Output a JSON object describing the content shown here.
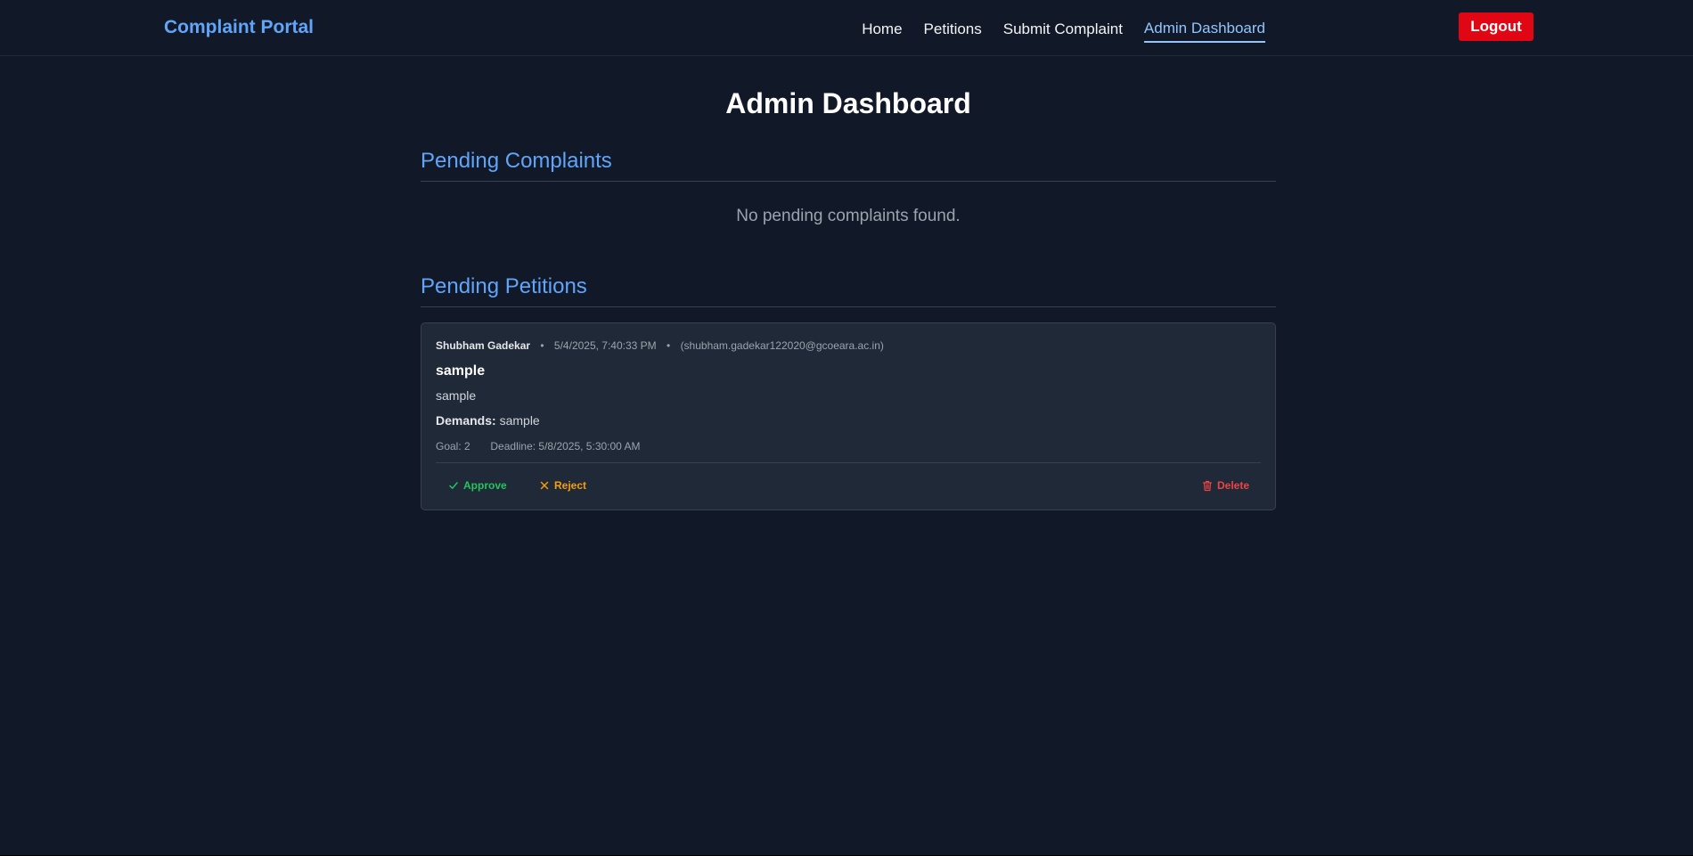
{
  "navbar": {
    "brand": "Complaint Portal",
    "links": [
      {
        "label": "Home"
      },
      {
        "label": "Petitions"
      },
      {
        "label": "Submit Complaint"
      },
      {
        "label": "Admin Dashboard",
        "active": true
      }
    ],
    "logout_label": "Logout"
  },
  "page": {
    "title": "Admin Dashboard"
  },
  "complaints": {
    "heading": "Pending Complaints",
    "empty_message": "No pending complaints found."
  },
  "petitions": {
    "heading": "Pending Petitions",
    "items": [
      {
        "author": "Shubham Gadekar",
        "date": "5/4/2025, 7:40:33 PM",
        "email": "(shubham.gadekar122020@gcoeara.ac.in)",
        "title": "sample",
        "description": "sample",
        "demands_label": "Demands:",
        "demands": "sample",
        "goal": "Goal: 2",
        "deadline": "Deadline: 5/8/2025, 5:30:00 AM",
        "actions": {
          "approve": "Approve",
          "reject": "Reject",
          "delete": "Delete"
        }
      }
    ]
  },
  "colors": {
    "background": "#111827",
    "card": "#1f2937",
    "accent": "#60a5fa",
    "logout": "#e10613",
    "approve": "#22c55e",
    "reject": "#f59e0b",
    "delete": "#ef4444"
  },
  "icons": {
    "approve": "check-icon",
    "reject": "x-icon",
    "delete": "trash-icon"
  }
}
